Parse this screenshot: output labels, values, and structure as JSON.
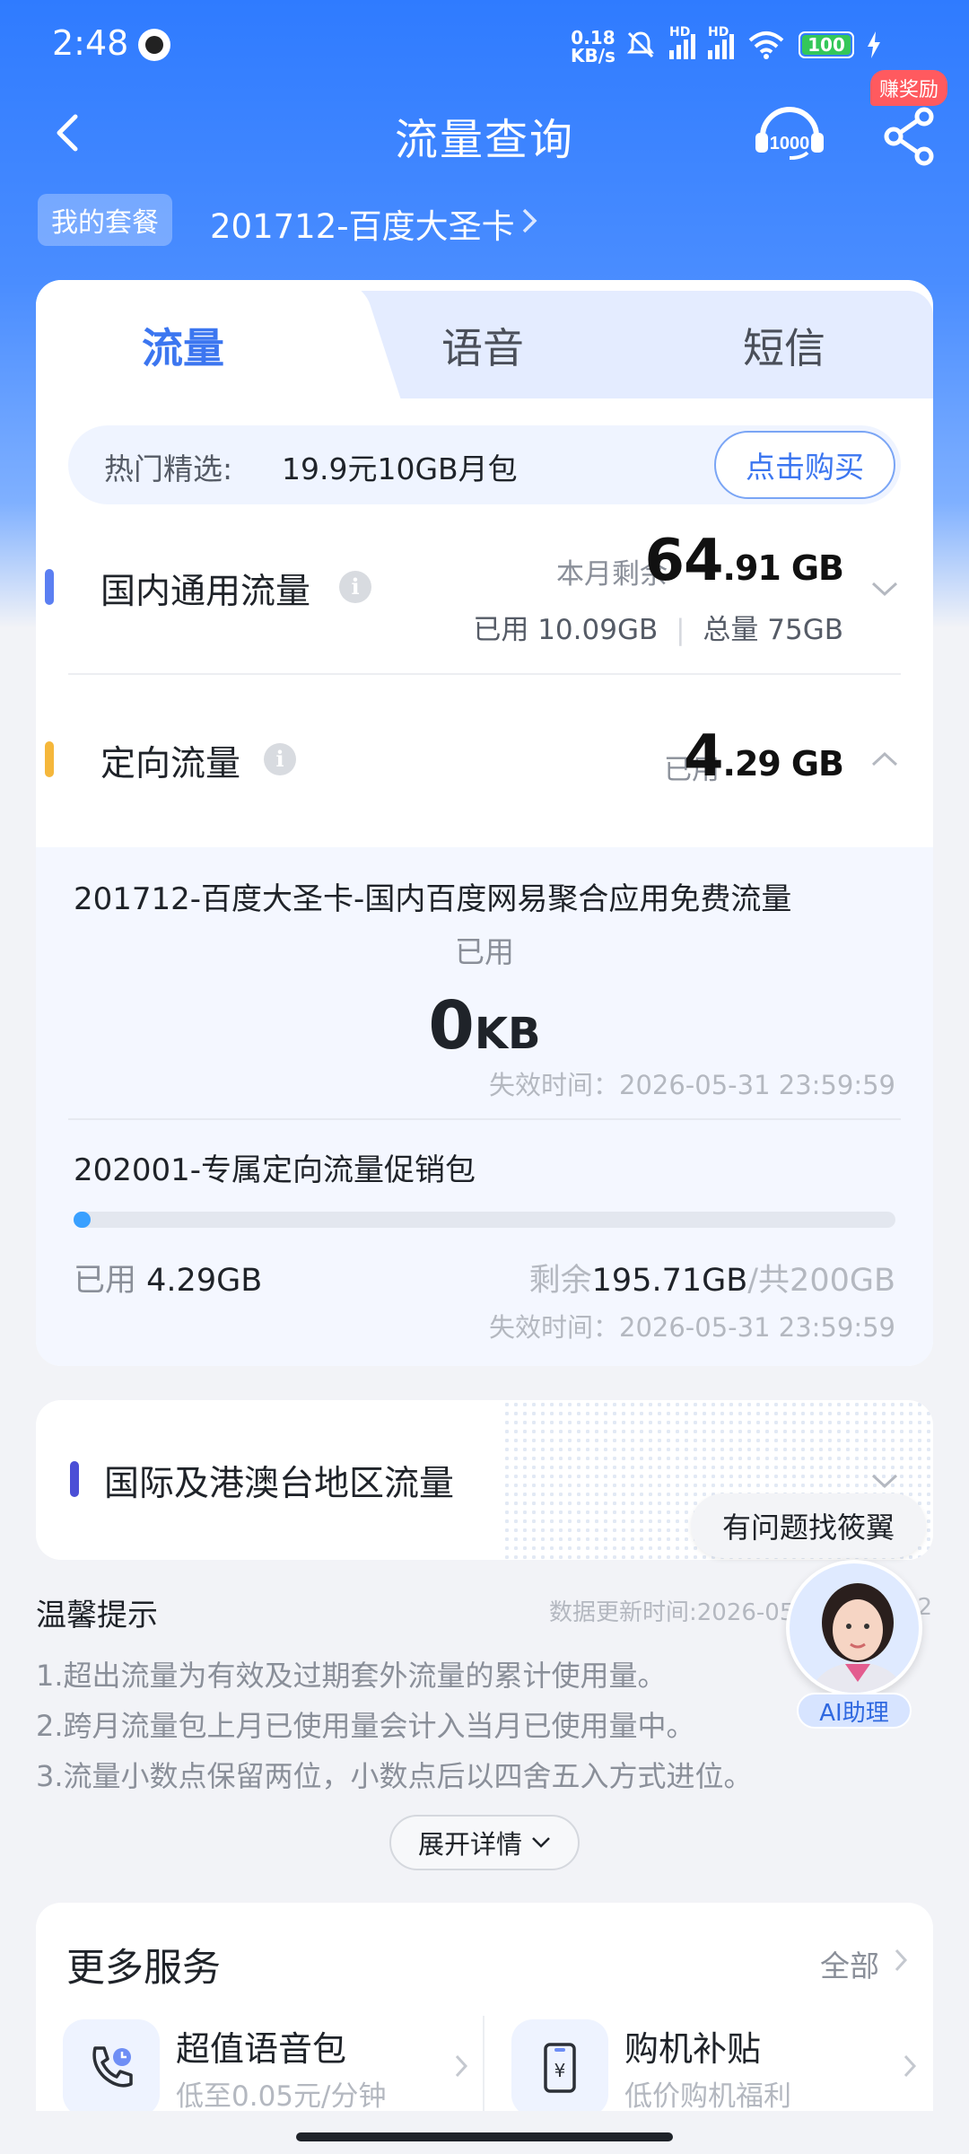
{
  "status_bar": {
    "time": "2:48",
    "speed_value": "0.18",
    "speed_unit": "KB/s",
    "battery": "100",
    "hd1": "HD",
    "hd2": "HD"
  },
  "nav": {
    "title": "流量查询",
    "reward_badge": "赚奖励"
  },
  "plan": {
    "tag": "我的套餐",
    "name": "201712-百度大圣卡"
  },
  "tabs": [
    {
      "label": "流量",
      "active": true
    },
    {
      "label": "语音",
      "active": false
    },
    {
      "label": "短信",
      "active": false
    }
  ],
  "promo": {
    "label": "热门精选:",
    "text": "19.9元10GB月包",
    "button": "点击购买"
  },
  "domestic": {
    "title": "国内通用流量",
    "remain_label": "本月剩余",
    "remain_int": "64",
    "remain_dec": ".91",
    "remain_unit": "GB",
    "used": "已用 10.09GB",
    "total": "总量 75GB",
    "accent": "#5b7ff2"
  },
  "directional": {
    "title": "定向流量",
    "used_label": "已用",
    "used_int": "4",
    "used_dec": ".29",
    "used_unit": "GB",
    "accent": "#f5b73b",
    "packages": [
      {
        "name": "201712-百度大圣卡-国内百度网易聚合应用免费流量",
        "used_label": "已用",
        "used_value": "0",
        "used_unit": "KB",
        "expire": "失效时间：2026-05-31 23:59:59"
      },
      {
        "name": "202001-专属定向流量促销包",
        "used_label": "已用",
        "used_value": "4.29GB",
        "remain_label": "剩余",
        "remain_value": "195.71GB",
        "total_label": "/共200GB",
        "progress": 0.021,
        "expire": "失效时间：2026-05-31 23:59:59"
      }
    ]
  },
  "international": {
    "title": "国际及港澳台地区流量",
    "accent": "#4b4fd6"
  },
  "help": {
    "bubble": "有问题找筱翼",
    "ai_label": "AI助理"
  },
  "tips": {
    "title": "温馨提示",
    "update_time": "数据更新时间:2026-05",
    "update_time_tail": "12",
    "items": [
      "1.超出流量为有效及过期套外流量的累计使用量。",
      "2.跨月流量包上月已使用量会计入当月已使用量中。",
      "3.流量小数点保留两位，小数点后以四舍五入方式进位。"
    ],
    "expand": "展开详情"
  },
  "more_services": {
    "title": "更多服务",
    "all": "全部",
    "items": [
      {
        "name": "超值语音包",
        "sub": "低至0.05元/分钟",
        "icon": "phone-clock-icon"
      },
      {
        "name": "购机补贴",
        "sub": "低价购机福利",
        "icon": "yen-phone-icon"
      }
    ]
  }
}
